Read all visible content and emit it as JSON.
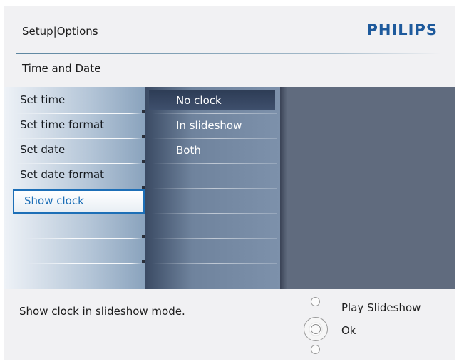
{
  "header": {
    "breadcrumb": "Setup|Options",
    "brand": "PHILIPS",
    "section": "Time and Date"
  },
  "menu": {
    "items": [
      {
        "label": "Set time"
      },
      {
        "label": "Set time format"
      },
      {
        "label": "Set date"
      },
      {
        "label": "Set date format"
      },
      {
        "label": "Show clock",
        "selected": true
      }
    ]
  },
  "submenu": {
    "items": [
      {
        "label": "No clock",
        "selected": true
      },
      {
        "label": "In slideshow"
      },
      {
        "label": "Both"
      }
    ]
  },
  "footer": {
    "hint": "Show clock in slideshow mode.",
    "play_label": "Play Slideshow",
    "ok_label": "Ok"
  },
  "colors": {
    "brand": "#1e5a9c",
    "selection_border": "#1d6fb7",
    "panel": "#606b7e"
  }
}
